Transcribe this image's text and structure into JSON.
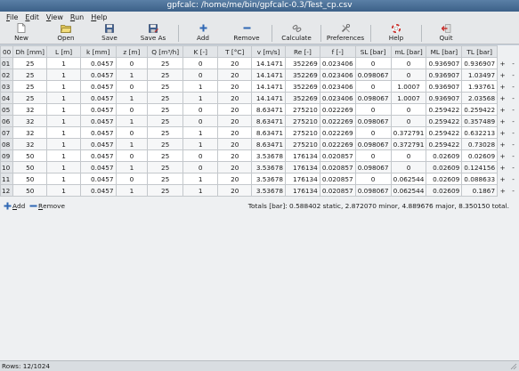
{
  "window": {
    "title": "gpfcalc: /home/me/bin/gpfcalc-0.3/Test_cp.csv"
  },
  "menubar": [
    {
      "u": "F",
      "rest": "ile"
    },
    {
      "u": "E",
      "rest": "dit"
    },
    {
      "u": "V",
      "rest": "iew"
    },
    {
      "u": "R",
      "rest": "un"
    },
    {
      "u": "H",
      "rest": "elp"
    }
  ],
  "toolbar": {
    "new": "New",
    "open": "Open",
    "save": "Save",
    "save_as": "Save As",
    "add": "Add",
    "remove": "Remove",
    "calculate": "Calculate",
    "preferences": "Preferences",
    "help": "Help",
    "quit": "Quit"
  },
  "table": {
    "corner": "00",
    "columns": [
      "Dh [mm]",
      "L [m]",
      "k [mm]",
      "z [m]",
      "Q [m³/h]",
      "K [-]",
      "T [°C]",
      "v [m/s]",
      "Re [-]",
      "f [-]",
      "SL [bar]",
      "mL [bar]",
      "ML [bar]",
      "TL [bar]"
    ],
    "add_symbol": "+",
    "remove_symbol": "-",
    "rows": [
      [
        "01",
        "25",
        "1",
        "0.0457",
        "0",
        "25",
        "0",
        "20",
        "14.1471",
        "352269",
        "0.023406",
        "0",
        "0",
        "0.936907",
        "0.936907"
      ],
      [
        "02",
        "25",
        "1",
        "0.0457",
        "1",
        "25",
        "0",
        "20",
        "14.1471",
        "352269",
        "0.023406",
        "0.098067",
        "0",
        "0.936907",
        "1.03497"
      ],
      [
        "03",
        "25",
        "1",
        "0.0457",
        "0",
        "25",
        "1",
        "20",
        "14.1471",
        "352269",
        "0.023406",
        "0",
        "1.0007",
        "0.936907",
        "1.93761"
      ],
      [
        "04",
        "25",
        "1",
        "0.0457",
        "1",
        "25",
        "1",
        "20",
        "14.1471",
        "352269",
        "0.023406",
        "0.098067",
        "1.0007",
        "0.936907",
        "2.03568"
      ],
      [
        "05",
        "32",
        "1",
        "0.0457",
        "0",
        "25",
        "0",
        "20",
        "8.63471",
        "275210",
        "0.022269",
        "0",
        "0",
        "0.259422",
        "0.259422"
      ],
      [
        "06",
        "32",
        "1",
        "0.0457",
        "1",
        "25",
        "0",
        "20",
        "8.63471",
        "275210",
        "0.022269",
        "0.098067",
        "0",
        "0.259422",
        "0.357489"
      ],
      [
        "07",
        "32",
        "1",
        "0.0457",
        "0",
        "25",
        "1",
        "20",
        "8.63471",
        "275210",
        "0.022269",
        "0",
        "0.372791",
        "0.259422",
        "0.632213"
      ],
      [
        "08",
        "32",
        "1",
        "0.0457",
        "1",
        "25",
        "1",
        "20",
        "8.63471",
        "275210",
        "0.022269",
        "0.098067",
        "0.372791",
        "0.259422",
        "0.73028"
      ],
      [
        "09",
        "50",
        "1",
        "0.0457",
        "0",
        "25",
        "0",
        "20",
        "3.53678",
        "176134",
        "0.020857",
        "0",
        "0",
        "0.02609",
        "0.02609"
      ],
      [
        "10",
        "50",
        "1",
        "0.0457",
        "1",
        "25",
        "0",
        "20",
        "3.53678",
        "176134",
        "0.020857",
        "0.098067",
        "0",
        "0.02609",
        "0.124156"
      ],
      [
        "11",
        "50",
        "1",
        "0.0457",
        "0",
        "25",
        "1",
        "20",
        "3.53678",
        "176134",
        "0.020857",
        "0",
        "0.062544",
        "0.02609",
        "0.088633"
      ],
      [
        "12",
        "50",
        "1",
        "0.0457",
        "1",
        "25",
        "1",
        "20",
        "3.53678",
        "176134",
        "0.020857",
        "0.098067",
        "0.062544",
        "0.02609",
        "0.1867"
      ]
    ]
  },
  "bottom": {
    "add_u": "A",
    "add_rest": "dd",
    "remove_u": "R",
    "remove_rest": "emove",
    "totals": "Totals [bar]: 0.588402 static, 2.872070 minor, 4.889676 major, 8.350150 total."
  },
  "status": {
    "rows": "Rows: 12/1024"
  },
  "icons": {
    "new": "new-file-icon",
    "open": "open-folder-icon",
    "save": "save-disk-icon",
    "save_as": "save-as-icon",
    "add": "plus-icon",
    "remove": "minus-icon",
    "calculate": "link-icon",
    "preferences": "tools-icon",
    "help": "lifebuoy-icon",
    "quit": "exit-icon"
  },
  "colors": {
    "title_bar": "#4a6f96",
    "add_plus": "#2f67b4",
    "remove_minus": "#2f67b4",
    "quit_red": "#c9302c"
  }
}
